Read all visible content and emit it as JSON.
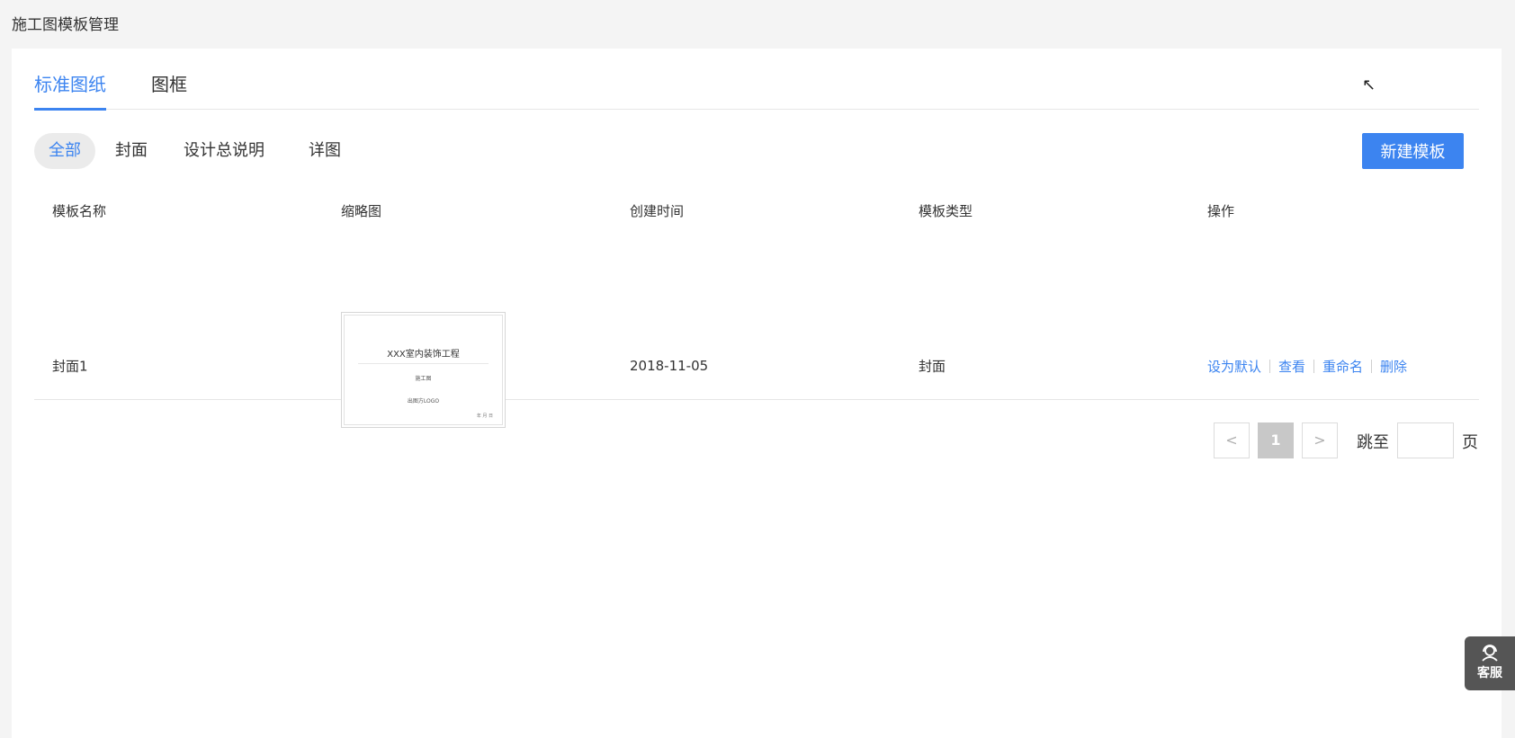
{
  "page": {
    "title": "施工图模板管理"
  },
  "tabs": [
    {
      "label": "标准图纸",
      "active": true
    },
    {
      "label": "图框",
      "active": false
    }
  ],
  "filters": [
    {
      "label": "全部",
      "active": true
    },
    {
      "label": "封面",
      "active": false
    },
    {
      "label": "设计总说明",
      "active": false
    },
    {
      "label": "详图",
      "active": false
    }
  ],
  "toolbar": {
    "new_label": "新建模板"
  },
  "table": {
    "columns": [
      "模板名称",
      "缩略图",
      "创建时间",
      "模板类型",
      "操作"
    ],
    "rows": [
      {
        "name": "封面1",
        "thumbnail": {
          "title": "XXX室内装饰工程",
          "subtitle": "施工图",
          "logo": "出图方LOGO",
          "mark": "年 月 日"
        },
        "created": "2018-11-05",
        "type": "封面",
        "actions": [
          "设为默认",
          "查看",
          "重命名",
          "删除"
        ]
      }
    ]
  },
  "pagination": {
    "prev": "<",
    "current": "1",
    "next": ">",
    "jump_label": "跳至",
    "page_label": "页",
    "jump_value": ""
  },
  "service": {
    "label": "客服"
  },
  "colors": {
    "accent": "#3c84f0",
    "service_bg": "#555555"
  }
}
